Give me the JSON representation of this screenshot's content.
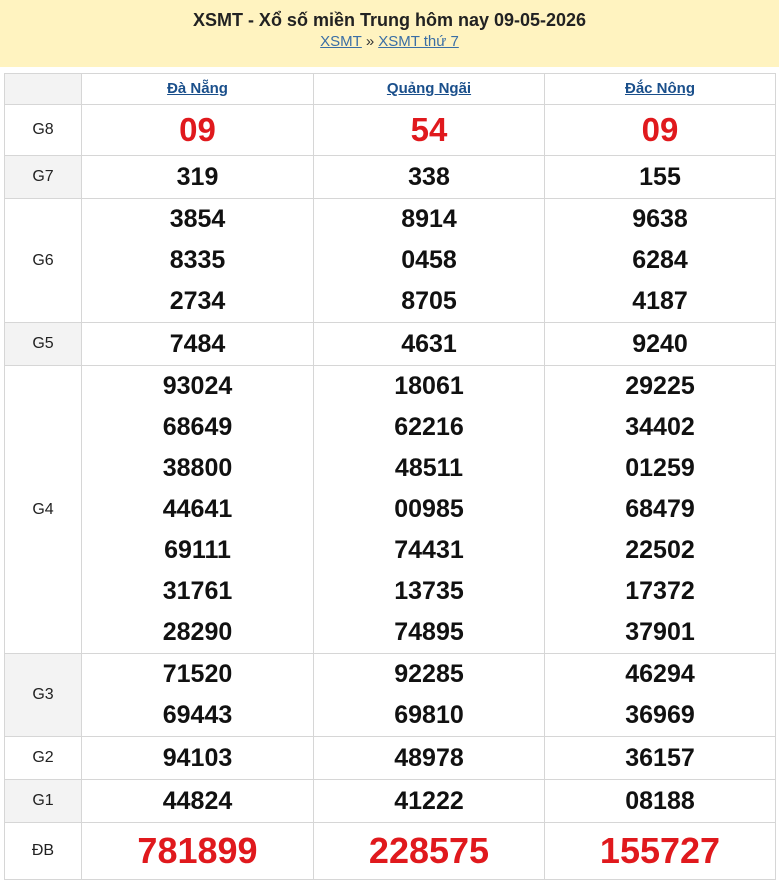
{
  "header": {
    "title": "XSMT - Xổ số miền Trung hôm nay 09-05-2026",
    "crumb1": "XSMT",
    "sep": "»",
    "crumb2": "XSMT thứ 7"
  },
  "colors": {
    "header_bg": "#fff3c0",
    "accent_red": "#e0191d",
    "link_blue": "#1a4f8b"
  },
  "provinces": [
    "Đà Nẵng",
    "Quảng Ngãi",
    "Đắc Nông"
  ],
  "prizes": [
    {
      "label": "G8",
      "values": [
        [
          "09"
        ],
        [
          "54"
        ],
        [
          "09"
        ]
      ]
    },
    {
      "label": "G7",
      "values": [
        [
          "319"
        ],
        [
          "338"
        ],
        [
          "155"
        ]
      ]
    },
    {
      "label": "G6",
      "values": [
        [
          "3854",
          "8335",
          "2734"
        ],
        [
          "8914",
          "0458",
          "8705"
        ],
        [
          "9638",
          "6284",
          "4187"
        ]
      ]
    },
    {
      "label": "G5",
      "values": [
        [
          "7484"
        ],
        [
          "4631"
        ],
        [
          "9240"
        ]
      ]
    },
    {
      "label": "G4",
      "values": [
        [
          "93024",
          "68649",
          "38800",
          "44641",
          "69111",
          "31761",
          "28290"
        ],
        [
          "18061",
          "62216",
          "48511",
          "00985",
          "74431",
          "13735",
          "74895"
        ],
        [
          "29225",
          "34402",
          "01259",
          "68479",
          "22502",
          "17372",
          "37901"
        ]
      ]
    },
    {
      "label": "G3",
      "values": [
        [
          "71520",
          "69443"
        ],
        [
          "92285",
          "69810"
        ],
        [
          "46294",
          "36969"
        ]
      ]
    },
    {
      "label": "G2",
      "values": [
        [
          "94103"
        ],
        [
          "48978"
        ],
        [
          "36157"
        ]
      ]
    },
    {
      "label": "G1",
      "values": [
        [
          "44824"
        ],
        [
          "41222"
        ],
        [
          "08188"
        ]
      ]
    },
    {
      "label": "ĐB",
      "values": [
        [
          "781899"
        ],
        [
          "228575"
        ],
        [
          "155727"
        ]
      ]
    }
  ]
}
